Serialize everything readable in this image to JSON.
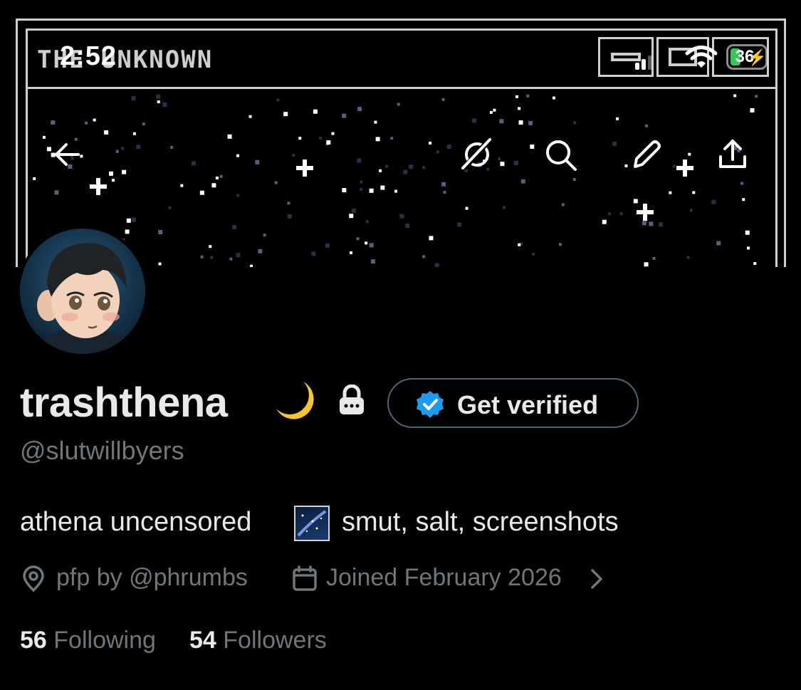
{
  "status_bar": {
    "time": "2:52",
    "battery_level": "36"
  },
  "banner": {
    "pixel_title": "THE UNKNOWN"
  },
  "profile": {
    "display_name": "trashthena",
    "handle": "@slutwillbyers",
    "get_verified_label": "Get verified",
    "bio_part1": "athena uncensored",
    "bio_emoji": "milky-way-emoji",
    "bio_part2": "smut, salt, screenshots",
    "location": "pfp by @phrumbs",
    "joined": "Joined February 2026",
    "following_count": "56",
    "following_label": "Following",
    "followers_count": "54",
    "followers_label": "Followers"
  },
  "icons": {
    "back": "arrow-left-icon",
    "grok": "grok-icon",
    "search": "search-icon",
    "edit": "pencil-icon",
    "share": "share-icon",
    "location": "location-pin-icon",
    "calendar": "calendar-icon",
    "chevron": "chevron-right-icon",
    "verified": "verified-badge-icon",
    "lock": "lock-icon",
    "moon": "crescent-moon-icon"
  },
  "colors": {
    "background": "#000000",
    "primary_text": "#e7e9ea",
    "secondary_text": "#71767b",
    "verified_blue": "#1d9bf0",
    "battery_green": "#34c759"
  }
}
